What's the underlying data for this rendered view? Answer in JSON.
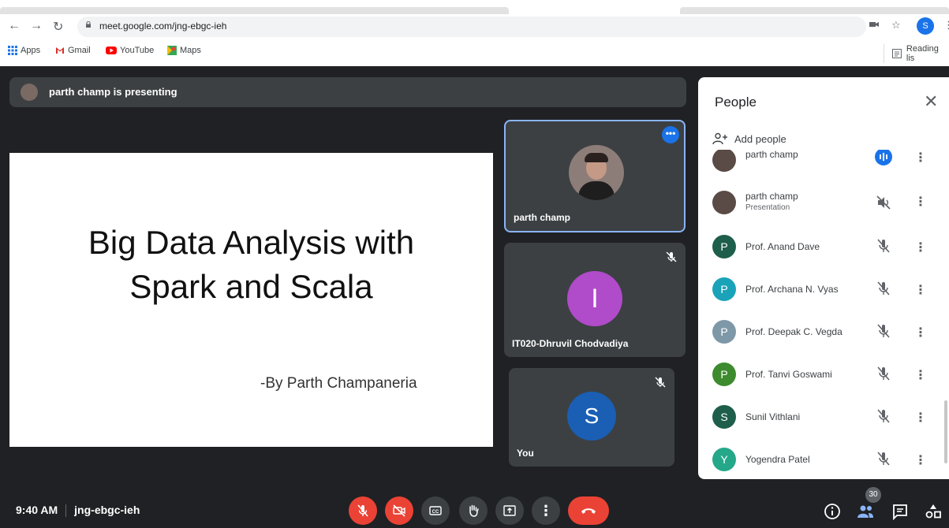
{
  "browser": {
    "url": "meet.google.com/jng-ebgc-ieh",
    "profile_initial": "S",
    "bookmarks": [
      "Apps",
      "Gmail",
      "YouTube",
      "Maps"
    ],
    "reading_list": "Reading lis"
  },
  "meet": {
    "presenting_text": "parth champ is presenting",
    "slide": {
      "title_line1": "Big Data Analysis with",
      "title_line2": "Spark and Scala",
      "author": "-By Parth Champaneria"
    },
    "tiles": [
      {
        "name": "parth champ"
      },
      {
        "name": "IT020-Dhruvil Chodvadiya",
        "initial": "I",
        "color": "#b04bc9"
      },
      {
        "name": "You",
        "initial": "S",
        "color": "#1a5fb4"
      }
    ],
    "people_panel": {
      "title": "People",
      "add_people": "Add people",
      "participants": [
        {
          "name": "parth champ",
          "sub": "",
          "initial": "",
          "color": "#5a4b46"
        },
        {
          "name": "parth champ",
          "sub": "Presentation",
          "initial": "",
          "color": "#5a4b46"
        },
        {
          "name": "Prof. Anand Dave",
          "sub": "",
          "initial": "P",
          "color": "#1e5e4a"
        },
        {
          "name": "Prof. Archana N. Vyas",
          "sub": "",
          "initial": "P",
          "color": "#1aa3b8"
        },
        {
          "name": "Prof. Deepak C. Vegda",
          "sub": "",
          "initial": "P",
          "color": "#7e98a8"
        },
        {
          "name": "Prof. Tanvi Goswami",
          "sub": "",
          "initial": "P",
          "color": "#3d8b2e"
        },
        {
          "name": "Sunil Vithlani",
          "sub": "",
          "initial": "S",
          "color": "#1e5e4a"
        },
        {
          "name": "Yogendra Patel",
          "sub": "",
          "initial": "Y",
          "color": "#24a889"
        }
      ]
    },
    "bottom": {
      "time": "9:40 AM",
      "meeting_code": "jng-ebgc-ieh",
      "participant_count": "30"
    }
  }
}
